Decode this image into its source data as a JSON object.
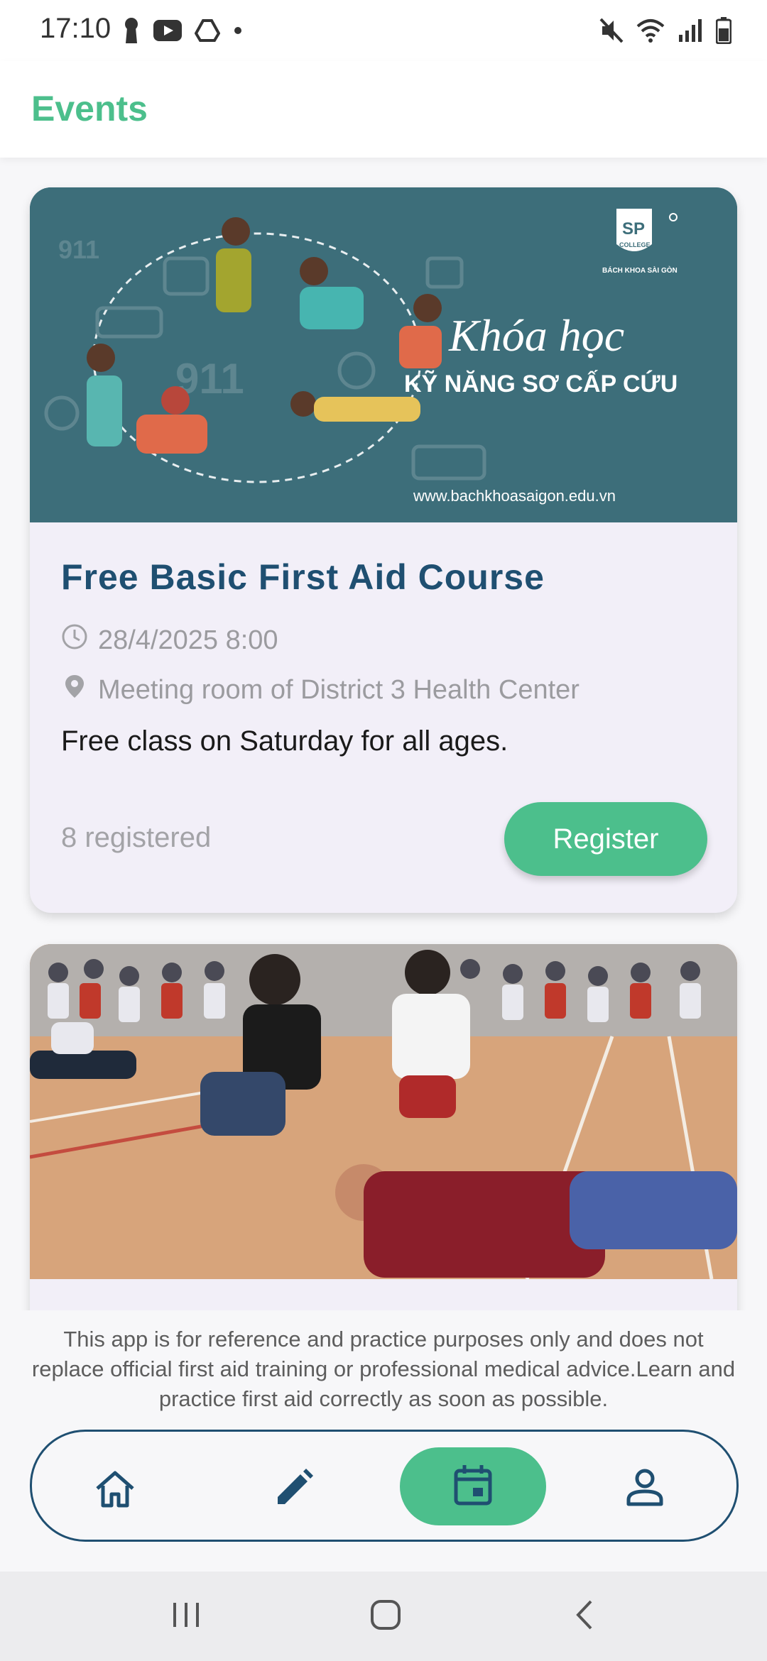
{
  "status_bar": {
    "time": "17:10",
    "left_icons": [
      "keyhole-icon",
      "youtube-icon",
      "drive-icon",
      "dot-icon"
    ],
    "right_icons": [
      "mute-icon",
      "wifi-icon",
      "signal-icon",
      "battery-icon"
    ]
  },
  "header": {
    "title": "Events"
  },
  "events": [
    {
      "banner": {
        "heading": "Khóa học",
        "subheading": "KỸ NĂNG SƠ CẤP CỨU",
        "url": "www.bachkhoasaigon.edu.vn",
        "logo_text": "SP",
        "logo_sub": "COLLEGE",
        "logo_caption": "BÁCH KHOA SÀI GÒN",
        "big_numbers": "911"
      },
      "title": "Free Basic First Aid Course",
      "datetime": "28/4/2025 8:00",
      "location": "Meeting room of District 3 Health Center",
      "description": "Free class on Saturday for all ages.",
      "registered": "8 registered",
      "register_label": "Register"
    },
    {
      "banner": {
        "scene": "children practicing first aid in gym"
      }
    }
  ],
  "disclaimer": "This app is for reference and practice purposes only and does not replace official first aid training or professional medical advice.Learn and practice first aid correctly as soon as possible.",
  "bottom_nav": {
    "items": [
      {
        "icon": "home-icon",
        "active": false
      },
      {
        "icon": "edit-icon",
        "active": false
      },
      {
        "icon": "calendar-icon",
        "active": true
      },
      {
        "icon": "profile-icon",
        "active": false
      }
    ]
  },
  "colors": {
    "accent": "#4cbf8c",
    "title": "#1f4f71",
    "banner": "#3d6e7a"
  }
}
